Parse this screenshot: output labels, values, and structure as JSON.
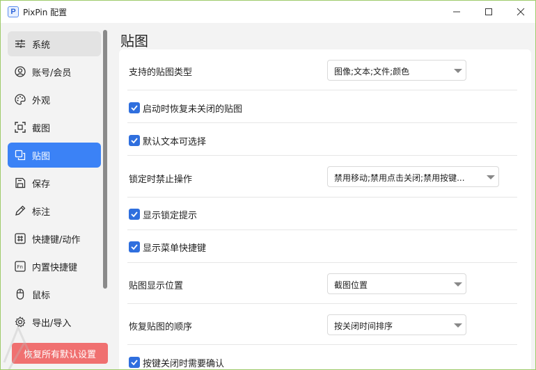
{
  "window": {
    "title": "PixPin 配置",
    "app_icon_letter": "P"
  },
  "sidebar": {
    "items": [
      {
        "label": "系统",
        "icon": "sliders-icon"
      },
      {
        "label": "账号/会员",
        "icon": "user-icon"
      },
      {
        "label": "外观",
        "icon": "palette-icon"
      },
      {
        "label": "截图",
        "icon": "screenshot-icon"
      },
      {
        "label": "贴图",
        "icon": "pin-copy-icon"
      },
      {
        "label": "保存",
        "icon": "save-icon"
      },
      {
        "label": "标注",
        "icon": "pencil-icon"
      },
      {
        "label": "快捷键/动作",
        "icon": "hash-icon"
      },
      {
        "label": "内置快捷键",
        "icon": "fn-key-icon"
      },
      {
        "label": "鼠标",
        "icon": "mouse-icon"
      },
      {
        "label": "导出/导入",
        "icon": "gear-icon"
      }
    ],
    "reset_label": "恢复所有默认设置"
  },
  "main": {
    "title": "贴图",
    "settings": {
      "types_label": "支持的贴图类型",
      "types_value": "图像;文本;文件;颜色",
      "restore_on_start": "启动时恢复未关闭的贴图",
      "text_selectable": "默认文本可选择",
      "lock_label": "锁定时禁止操作",
      "lock_value": "禁用移动;禁用点击关闭;禁用按键...",
      "show_lock_tip": "显示锁定提示",
      "show_menu_shortcut": "显示菜单快捷键",
      "position_label": "贴图显示位置",
      "position_value": "截图位置",
      "order_label": "恢复贴图的顺序",
      "order_value": "按关闭时间排序",
      "confirm_close": "按键关闭时需要确认"
    }
  },
  "colors": {
    "accent": "#3b82f6",
    "checkbox": "#2f6fde",
    "reset": "#f07070"
  }
}
